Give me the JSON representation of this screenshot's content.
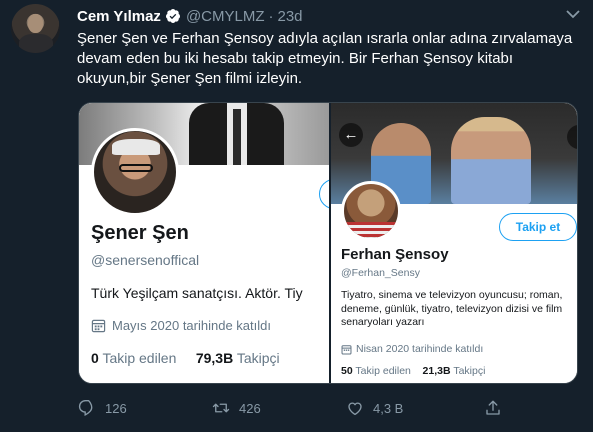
{
  "tweet": {
    "display_name": "Cem Yılmaz",
    "handle": "@CMYLMZ",
    "separator": "·",
    "time": "23d",
    "text": "Şener Şen ve Ferhan Şensoy adıyla açılan ısrarla onlar adına zırvalamaya devam eden bu iki hesabı takip etmeyin. Bir Ferhan Şensoy kitabı okuyun,bir Şener Şen filmi izleyin."
  },
  "left_card": {
    "name": "Şener Şen",
    "handle": "@senersenoffical",
    "bio": "Türk Yeşilçam sanatçısı. Aktör. Tiy",
    "joined": "Mayıs 2020 tarihinde katıldı",
    "following_count": "0",
    "following_label": "Takip edilen",
    "followers_count": "79,3B",
    "followers_label": "Takipçi"
  },
  "right_card": {
    "name": "Ferhan Şensoy",
    "handle": "@Ferhan_Sensy",
    "follow_button": "Takip et",
    "bio": "Tiyatro, sinema ve televizyon oyuncusu; roman, deneme, günlük, tiyatro, televizyon dizisi ve film senaryoları yazarı",
    "joined": "Nisan 2020 tarihinde katıldı",
    "following_count": "50",
    "following_label": "Takip edilen",
    "followers_count": "21,3B",
    "followers_label": "Takipçi"
  },
  "actions": {
    "reply_count": "126",
    "retweet_count": "426",
    "like_count": "4,3 B"
  },
  "icons": {
    "verified": "verified-badge-icon",
    "caret": "chevron-down-icon",
    "calendar": "calendar-icon",
    "back": "arrow-left-icon",
    "more": "more-dots-icon",
    "reply": "reply-icon",
    "retweet": "retweet-icon",
    "like": "heart-icon",
    "share": "share-icon"
  },
  "colors": {
    "background": "#15202b",
    "accent": "#1da1f2",
    "muted": "#8899a6"
  }
}
